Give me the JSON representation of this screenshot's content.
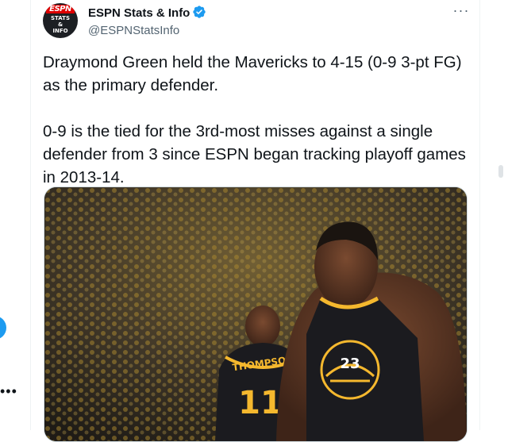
{
  "author": {
    "display_name": "ESPN Stats & Info",
    "handle": "@ESPNStatsInfo",
    "verified": true,
    "avatar_logo": "ESPN",
    "avatar_lines": [
      "STATS",
      "&",
      "INFO"
    ]
  },
  "tweet": {
    "paragraphs": [
      "Draymond Green held the Mavericks to 4-15 (0-9 3-pt FG) as the primary defender.",
      "0-9 is the tied for the 3rd-most misses against a single defender from 3 since ESPN began tracking playoff games in 2013-14."
    ]
  },
  "media": {
    "jersey_front_number": "23",
    "jersey_back_name": "THOMPSON",
    "jersey_back_number": "11"
  },
  "icons": {
    "more": "more-horizontal-icon",
    "verified": "verified-badge-icon"
  },
  "colors": {
    "accent": "#1d9bf0",
    "text": "#0f1419",
    "secondary": "#536471",
    "warriors_gold": "#f5b82e",
    "jersey": "#1b1b1f"
  }
}
